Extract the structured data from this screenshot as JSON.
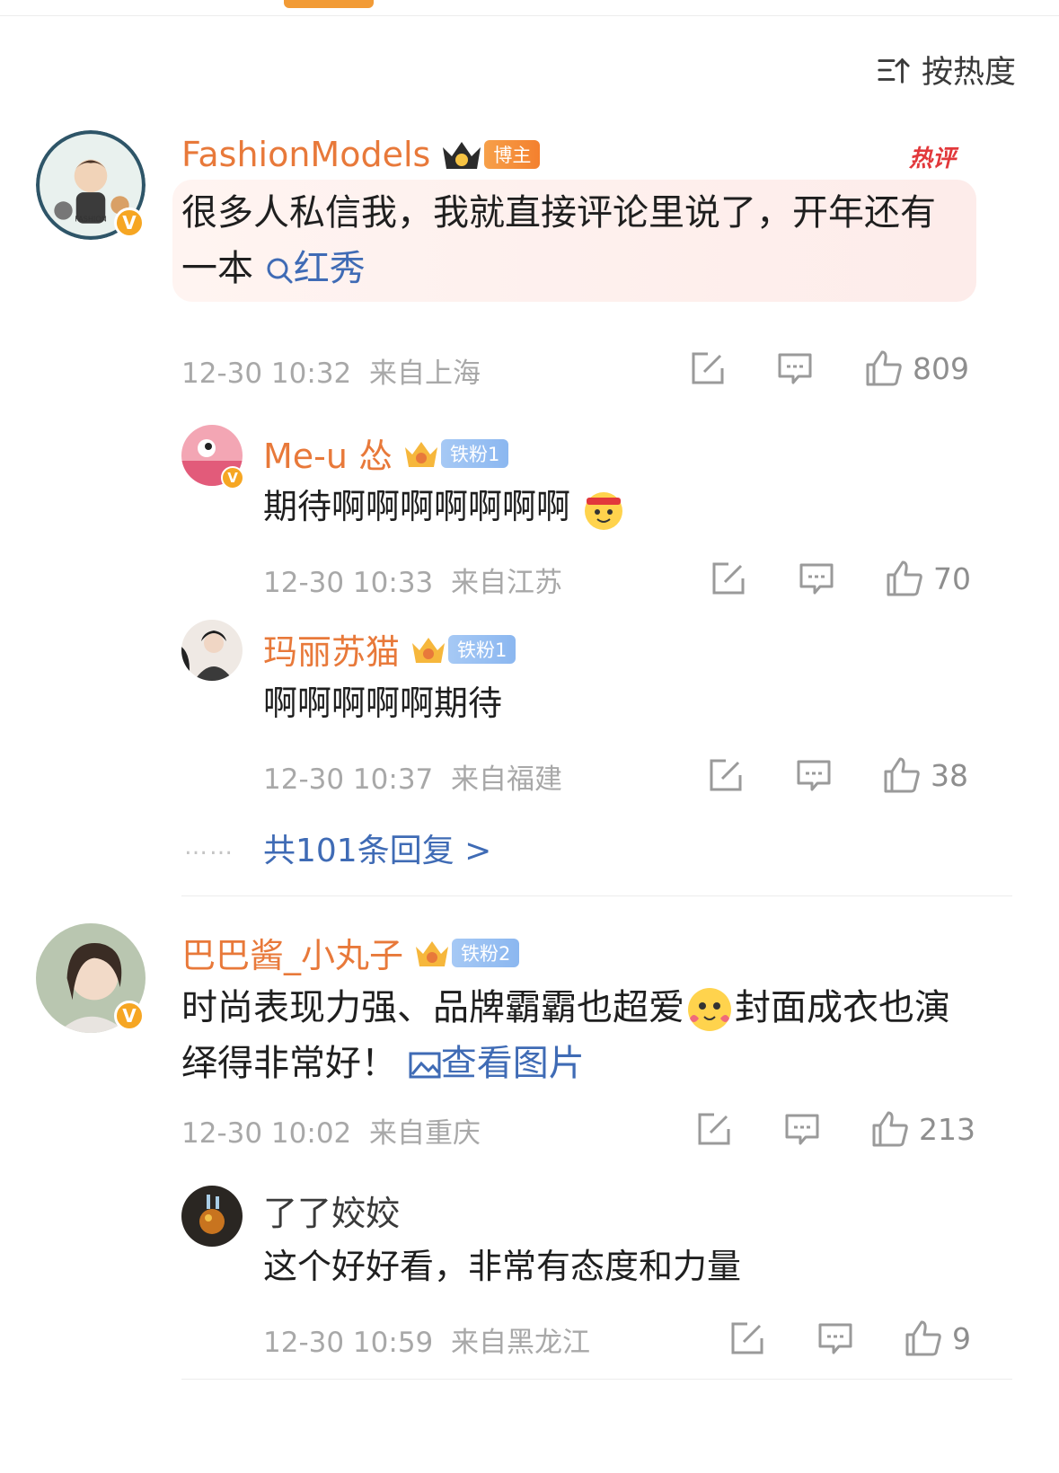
{
  "sort_label": "按热度",
  "comments": [
    {
      "user": "FashionModels",
      "badge_label": "博主",
      "hot_label": "热评",
      "text": "很多人私信我，我就直接评论里说了，开年还有一本",
      "search_link": "红秀",
      "time": "12-30 10:32",
      "location": "来自上海",
      "likes": "809"
    },
    {
      "user": "巴巴酱_小丸子",
      "badge_label": "铁粉2",
      "text_a": "时尚表现力强、品牌霸霸也超爱",
      "text_b": "封面成衣也演绎得非常好！",
      "image_link": "查看图片",
      "time": "12-30 10:02",
      "location": "来自重庆",
      "likes": "213"
    }
  ],
  "replies": [
    {
      "user": "Me-u 怂",
      "badge_label": "铁粉1",
      "text": "期待啊啊啊啊啊啊啊",
      "time": "12-30 10:33",
      "location": "来自江苏",
      "likes": "70"
    },
    {
      "user": "玛丽苏猫",
      "badge_label": "铁粉1",
      "text": "啊啊啊啊啊期待",
      "time": "12-30 10:37",
      "location": "来自福建",
      "likes": "38"
    },
    {
      "user": "了了姣姣",
      "text": "这个好好看，非常有态度和力量",
      "time": "12-30 10:59",
      "location": "来自黑龙江",
      "likes": "9"
    }
  ],
  "more_replies": "共101条回复 >",
  "more_dots": "……",
  "icons": {
    "sort": "sort-icon",
    "share": "share-icon",
    "comment": "comment-icon",
    "like": "thumbs-up-icon",
    "search": "search-icon",
    "image": "image-icon"
  },
  "colors": {
    "username": "#e8793a",
    "link": "#3f6bb5",
    "hot": "#e2383b"
  }
}
